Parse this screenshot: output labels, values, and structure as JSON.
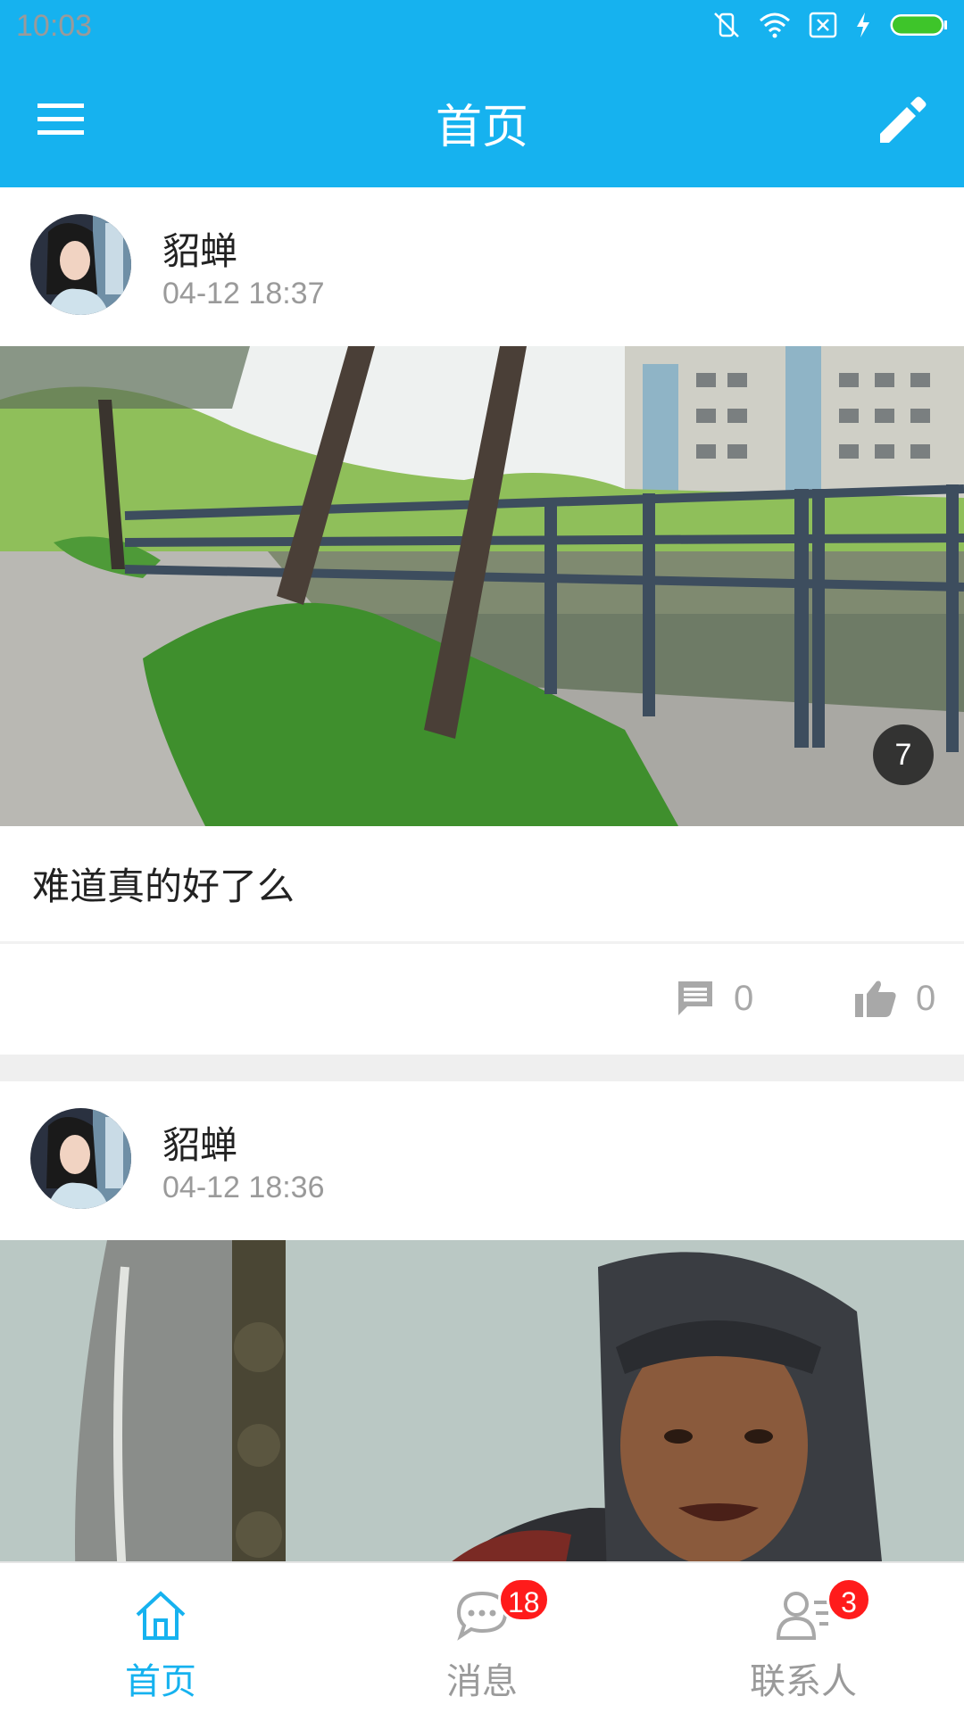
{
  "status_bar": {
    "time": "10:03"
  },
  "app_bar": {
    "title": "首页"
  },
  "posts": [
    {
      "author": "貂蝉",
      "time": "04-12 18:37",
      "image_count": "7",
      "caption": "难道真的好了么",
      "comments": "0",
      "likes": "0"
    },
    {
      "author": "貂蝉",
      "time": "04-12 18:36"
    }
  ],
  "bottom_nav": {
    "home": {
      "label": "首页"
    },
    "messages": {
      "label": "消息",
      "badge": "18"
    },
    "contacts": {
      "label": "联系人",
      "badge": "3"
    }
  },
  "colors": {
    "primary": "#16b2ef",
    "badge_red": "#ff1b1b",
    "muted": "#9a9a9a"
  }
}
